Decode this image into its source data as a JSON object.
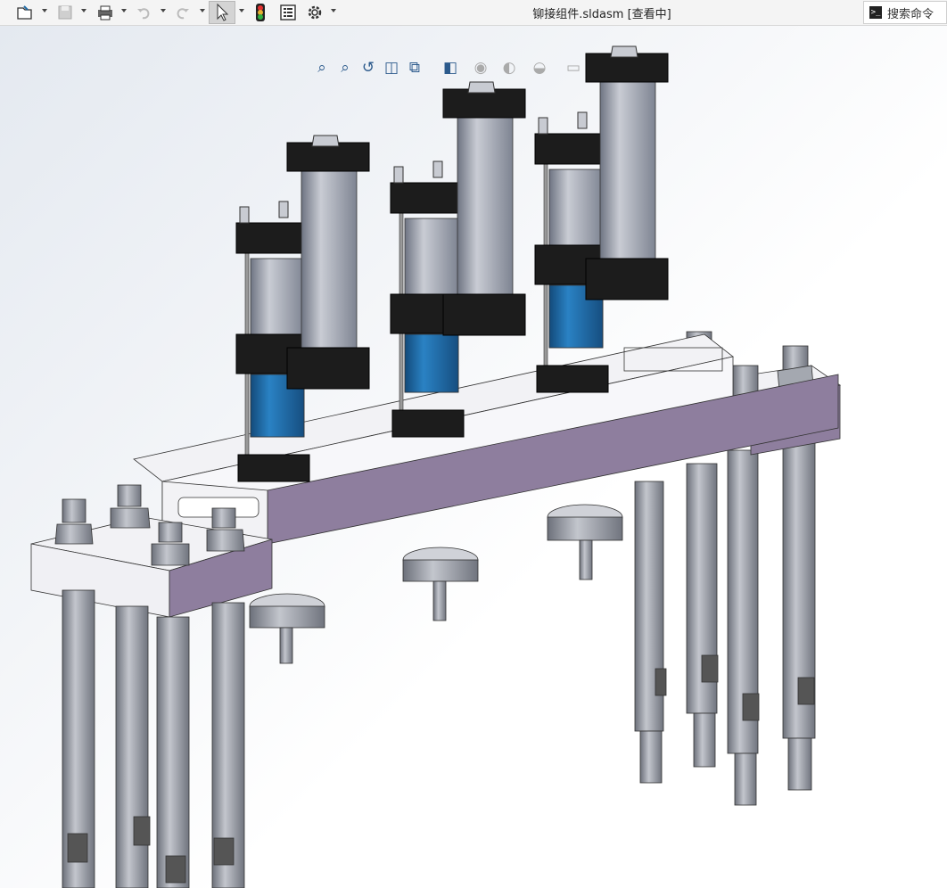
{
  "window": {
    "document_title": "铆接组件.sldasm [查看中]"
  },
  "toolbar": {
    "items": [
      {
        "name": "open-file-icon"
      },
      {
        "name": "save-icon"
      },
      {
        "name": "print-icon"
      },
      {
        "name": "undo-icon"
      },
      {
        "name": "redo-icon"
      },
      {
        "name": "select-cursor-icon"
      },
      {
        "name": "rebuild-traffic-light-icon"
      },
      {
        "name": "file-properties-icon"
      },
      {
        "name": "options-gear-icon"
      }
    ]
  },
  "search": {
    "label": "搜索命令"
  },
  "heads_up_toolbar": {
    "items": [
      "zoom-to-fit-icon",
      "zoom-to-area-icon",
      "previous-view-icon",
      "section-view-icon",
      "view-orientation-icon",
      "display-style-icon",
      "hide-show-items-icon",
      "edit-appearance-icon",
      "apply-scene-icon",
      "view-settings-icon"
    ]
  },
  "colors": {
    "plate_top": "#8e7e9e",
    "plate_side": "#f0f0f3",
    "cylinder_blue": "#1f6aa5",
    "cylinder_gray": "#9aa0ad",
    "cap_black": "#1c1c1c",
    "rod": "#9ea2aa"
  }
}
